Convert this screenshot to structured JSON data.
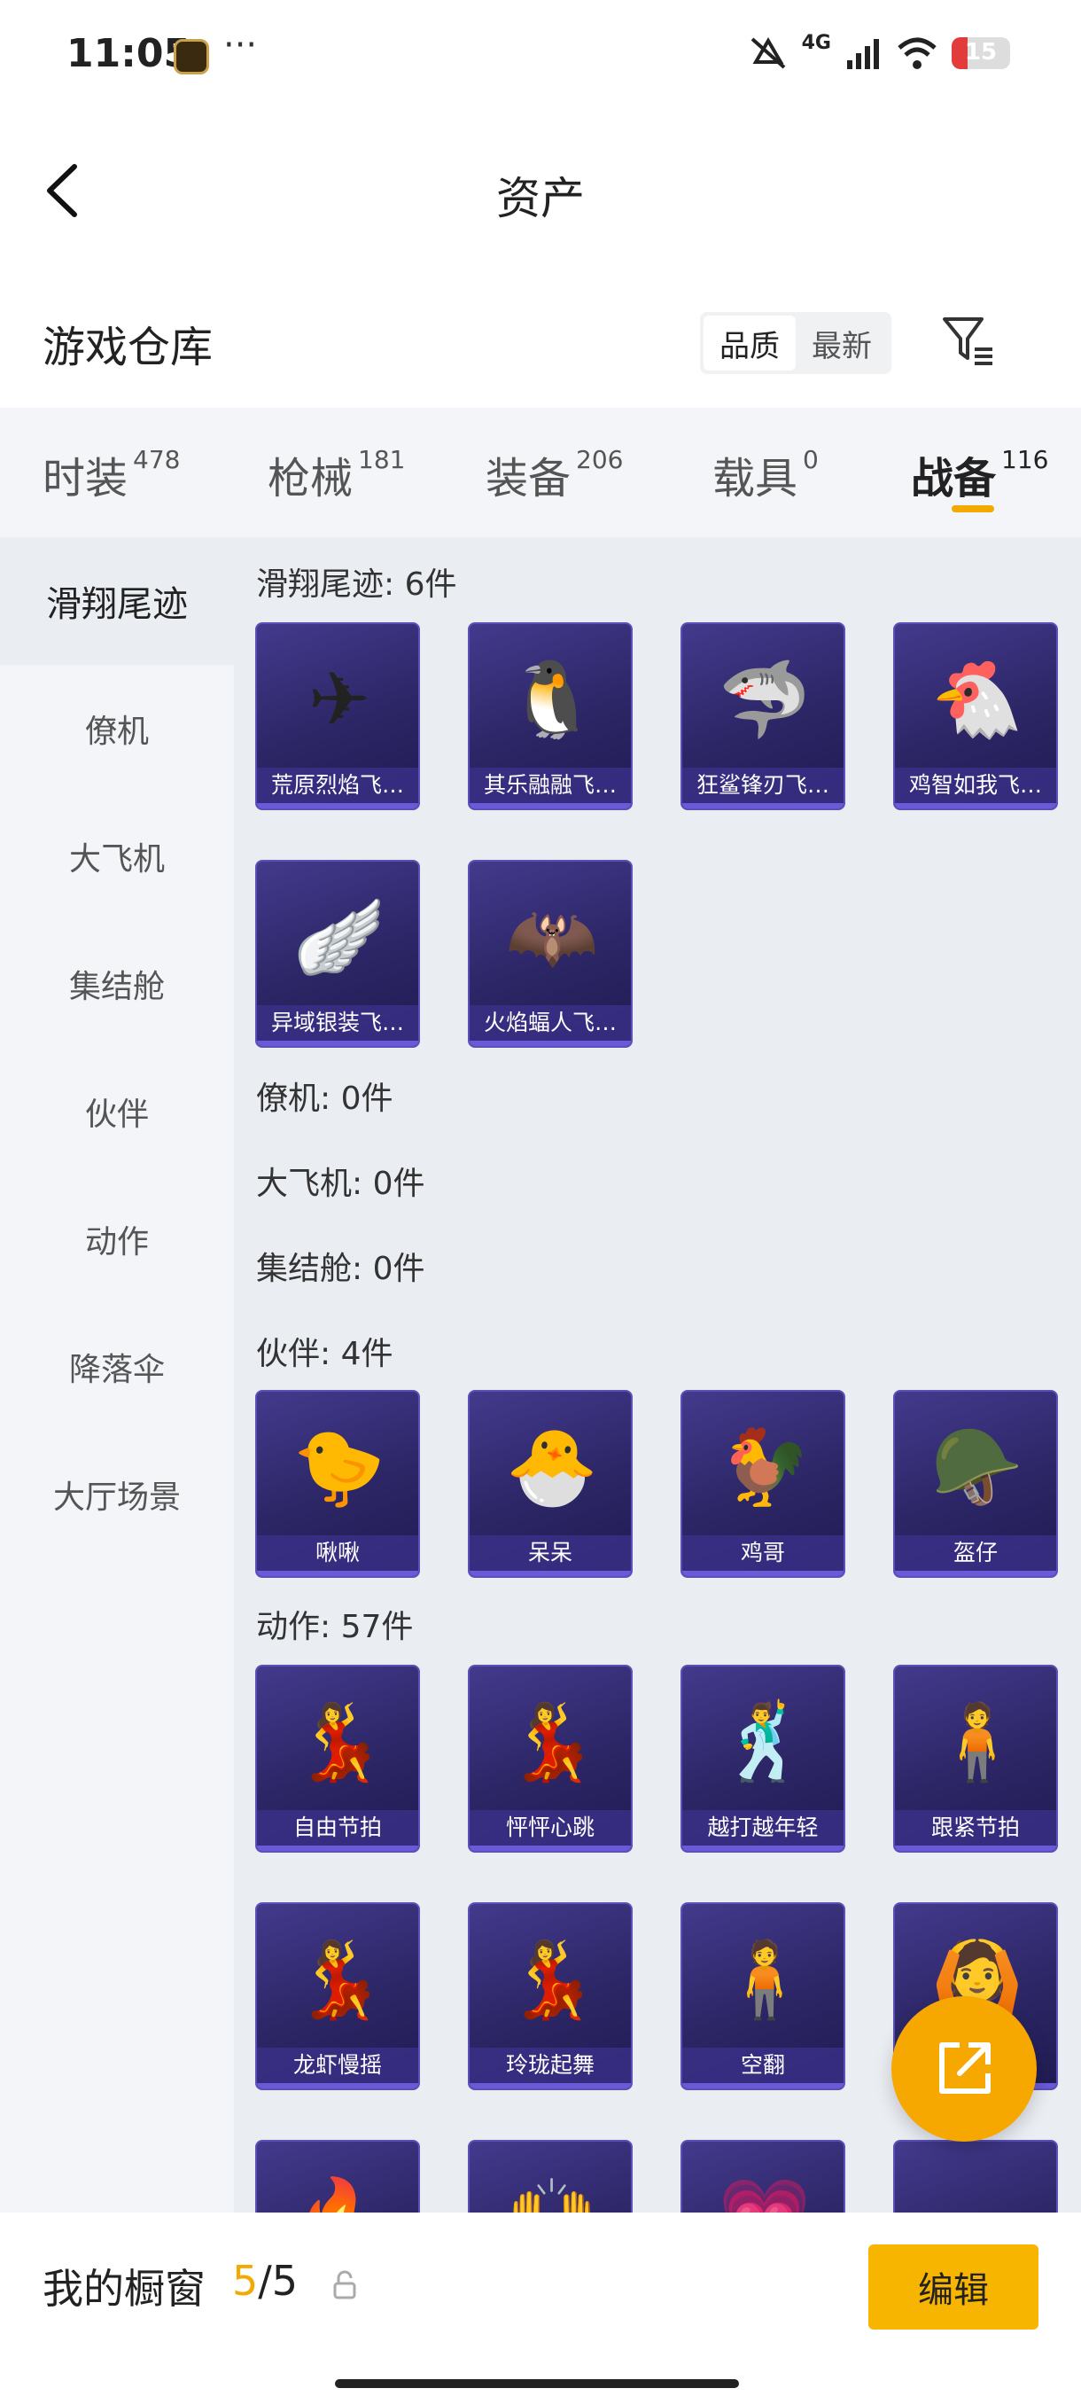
{
  "status": {
    "time": "11:05",
    "dots": "···",
    "network": "4G",
    "battery": "15"
  },
  "nav": {
    "title": "资产"
  },
  "warehouse": {
    "title": "游戏仓库",
    "sort_options": [
      "品质",
      "最新"
    ],
    "sort_selected": "品质"
  },
  "tabs": [
    {
      "label": "时装",
      "count": "478"
    },
    {
      "label": "枪械",
      "count": "181"
    },
    {
      "label": "装备",
      "count": "206"
    },
    {
      "label": "载具",
      "count": "0"
    },
    {
      "label": "战备",
      "count": "116",
      "active": true
    }
  ],
  "sidebar": {
    "items": [
      {
        "label": "滑翔尾迹",
        "active": true
      },
      {
        "label": "僚机"
      },
      {
        "label": "大飞机"
      },
      {
        "label": "集结舱"
      },
      {
        "label": "伙伴"
      },
      {
        "label": "动作"
      },
      {
        "label": "降落伞"
      },
      {
        "label": "大厅场景"
      }
    ]
  },
  "sections": {
    "glide": {
      "title": "滑翔尾迹: 6件",
      "items": [
        {
          "label": "荒原烈焰飞…",
          "icon": "flame-glider-icon",
          "glyph": "✈"
        },
        {
          "label": "其乐融融飞…",
          "icon": "penguin-glider-icon",
          "glyph": "🐧"
        },
        {
          "label": "狂鲨锋刃飞…",
          "icon": "shark-glider-icon",
          "glyph": "🦈"
        },
        {
          "label": "鸡智如我飞…",
          "icon": "chicken-glider-icon",
          "glyph": "🐔"
        },
        {
          "label": "异域银装飞…",
          "icon": "silver-wing-glider-icon",
          "glyph": "🪽"
        },
        {
          "label": "火焰蝠人飞…",
          "icon": "bat-man-glider-icon",
          "glyph": "🦇"
        }
      ]
    },
    "wingman": {
      "title": "僚机: 0件"
    },
    "bigplane": {
      "title": "大飞机: 0件"
    },
    "capsule": {
      "title": "集结舱: 0件"
    },
    "partner": {
      "title": "伙伴: 4件",
      "items": [
        {
          "label": "啾啾",
          "icon": "pink-bird-icon",
          "glyph": "🐤"
        },
        {
          "label": "呆呆",
          "icon": "chick-egg-icon",
          "glyph": "🐣"
        },
        {
          "label": "鸡哥",
          "icon": "cool-chicken-icon",
          "glyph": "🐓"
        },
        {
          "label": "盔仔",
          "icon": "helmet-chick-icon",
          "glyph": "🪖"
        }
      ]
    },
    "action": {
      "title": "动作: 57件",
      "items": [
        {
          "label": "自由节拍",
          "icon": "dance-pose-icon",
          "glyph": "💃"
        },
        {
          "label": "怦怦心跳",
          "icon": "dance-pose-icon",
          "glyph": "💃"
        },
        {
          "label": "越打越年轻",
          "icon": "dance-pose-icon",
          "glyph": "🕺"
        },
        {
          "label": "跟紧节拍",
          "icon": "dance-pose-icon",
          "glyph": "🧍"
        },
        {
          "label": "龙虾慢摇",
          "icon": "dance-pose-icon",
          "glyph": "💃"
        },
        {
          "label": "玲珑起舞",
          "icon": "dance-pose-icon",
          "glyph": "💃"
        },
        {
          "label": "空翻",
          "icon": "dance-pose-icon",
          "glyph": "🧍"
        },
        {
          "label": "",
          "icon": "golden-halo-pose-icon",
          "glyph": "🙆"
        },
        {
          "label": "",
          "icon": "fire-pose-icon",
          "glyph": "🔥"
        },
        {
          "label": "",
          "icon": "dance-pose-icon",
          "glyph": "🙌"
        },
        {
          "label": "",
          "icon": "heart-pose-icon",
          "glyph": "💗"
        },
        {
          "label": "",
          "icon": "cloud-pose-icon",
          "glyph": "☁"
        }
      ]
    }
  },
  "bottom": {
    "window_label": "我的橱窗",
    "current": "5",
    "total": "/5",
    "edit_label": "编辑"
  },
  "colors": {
    "accent": "#f7b500",
    "card_bg": "#2c2666",
    "card_border": "#5a50b8",
    "sidebar_bg": "#f3f5f8",
    "content_bg": "#eaedf2"
  }
}
